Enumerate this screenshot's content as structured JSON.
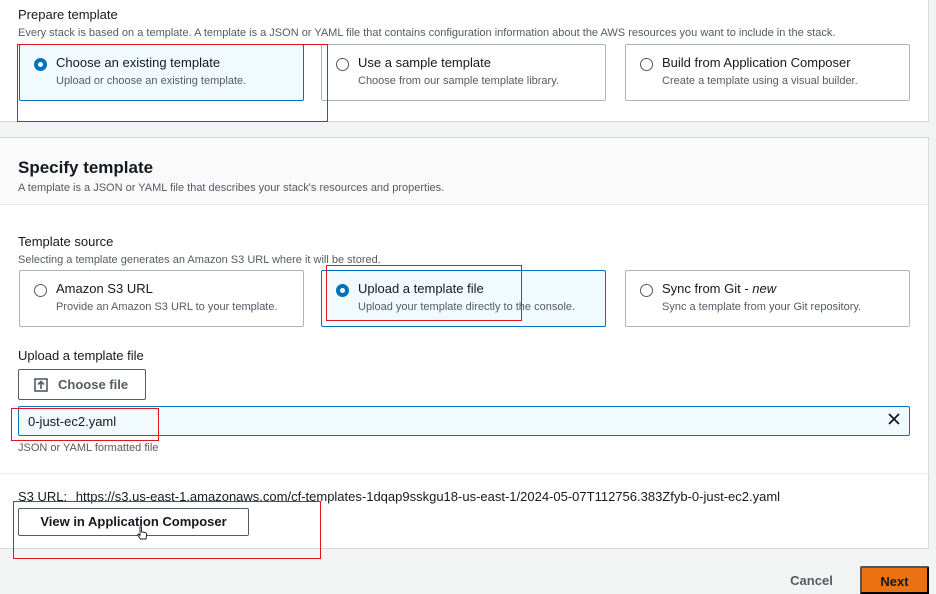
{
  "prepare": {
    "title": "Prepare template",
    "description": "Every stack is based on a template. A template is a JSON or YAML file that contains configuration information about the AWS resources you want to include in the stack.",
    "options": [
      {
        "title": "Choose an existing template",
        "desc": "Upload or choose an existing template.",
        "selected": true
      },
      {
        "title": "Use a sample template",
        "desc": "Choose from our sample template library.",
        "selected": false
      },
      {
        "title": "Build from Application Composer",
        "desc": "Create a template using a visual builder.",
        "selected": false
      }
    ]
  },
  "specify": {
    "title": "Specify template",
    "description": "A template is a JSON or YAML file that describes your stack's resources and properties."
  },
  "source": {
    "label": "Template source",
    "description": "Selecting a template generates an Amazon S3 URL where it will be stored.",
    "options": [
      {
        "title": "Amazon S3 URL",
        "desc": "Provide an Amazon S3 URL to your template.",
        "selected": false
      },
      {
        "title": "Upload a template file",
        "desc": "Upload your template directly to the console.",
        "selected": true
      },
      {
        "title": "Sync from Git - ",
        "title_em": "new",
        "desc": "Sync a template from your Git repository.",
        "selected": false
      }
    ]
  },
  "upload": {
    "label": "Upload a template file",
    "choose_button": "Choose file",
    "file_name": "0-just-ec2.yaml",
    "hint": "JSON or YAML formatted file"
  },
  "s3": {
    "label": "S3 URL:",
    "url": "https://s3.us-east-1.amazonaws.com/cf-templates-1dqap9sskgu18-us-east-1/2024-05-07T112756.383Zfyb-0-just-ec2.yaml"
  },
  "view_button": "View in Application Composer",
  "footer": {
    "cancel": "Cancel",
    "next": "Next"
  },
  "colors": {
    "accent": "#0073bb",
    "primary_button": "#ec7211",
    "annotation": "#e2141c"
  },
  "icons": [
    "upload-icon",
    "clear-icon",
    "hand-cursor-icon"
  ]
}
